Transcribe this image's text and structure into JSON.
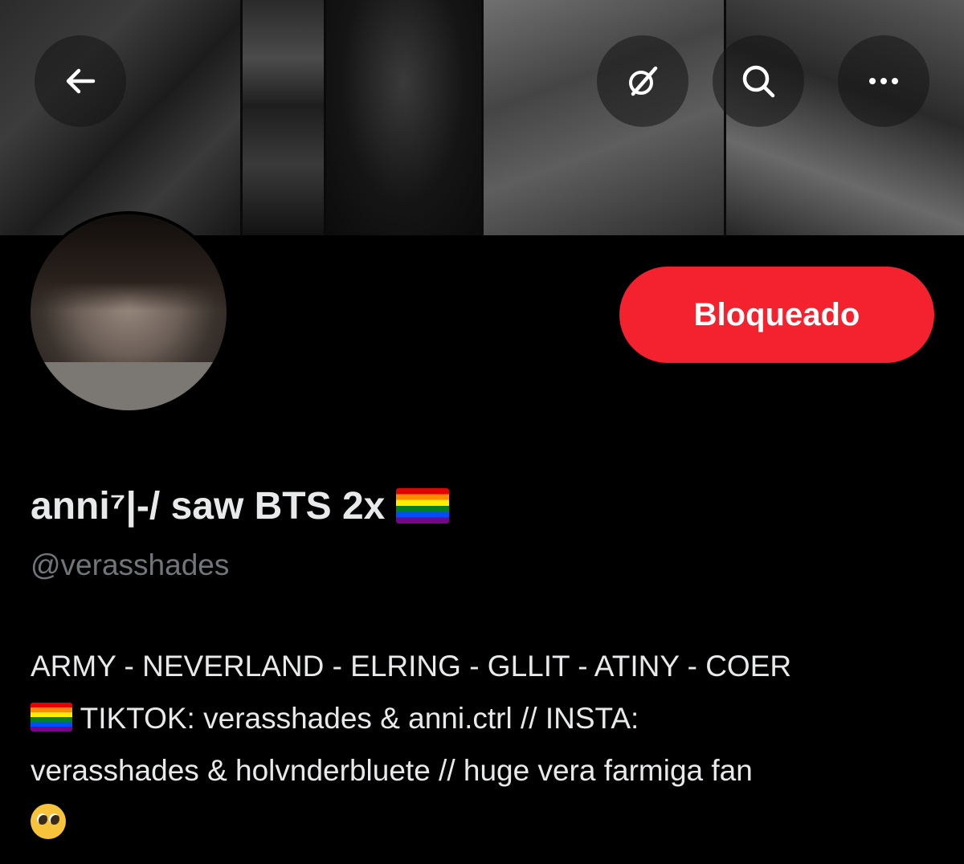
{
  "header": {
    "back_icon": "arrow-left-icon",
    "grok_icon": "grok-icon",
    "search_icon": "search-icon",
    "more_icon": "more-horizontal-icon"
  },
  "profile": {
    "display_name": "anni⁷|-/ saw BTS 2x",
    "handle": "@verasshades",
    "blocked_label": "Bloqueado",
    "bio": {
      "line1": "ARMY - NEVERLAND - ELRING - GLLIT - ATINY - COER",
      "line2_text": " TIKTOK: verasshades & anni.ctrl // INSTA:",
      "line3": "verasshades & holvnderbluete // huge vera farmiga fan"
    }
  },
  "colors": {
    "background": "#000000",
    "blocked_button": "#f4212e",
    "text_primary": "#e7e9ea",
    "text_secondary": "#71767b"
  }
}
